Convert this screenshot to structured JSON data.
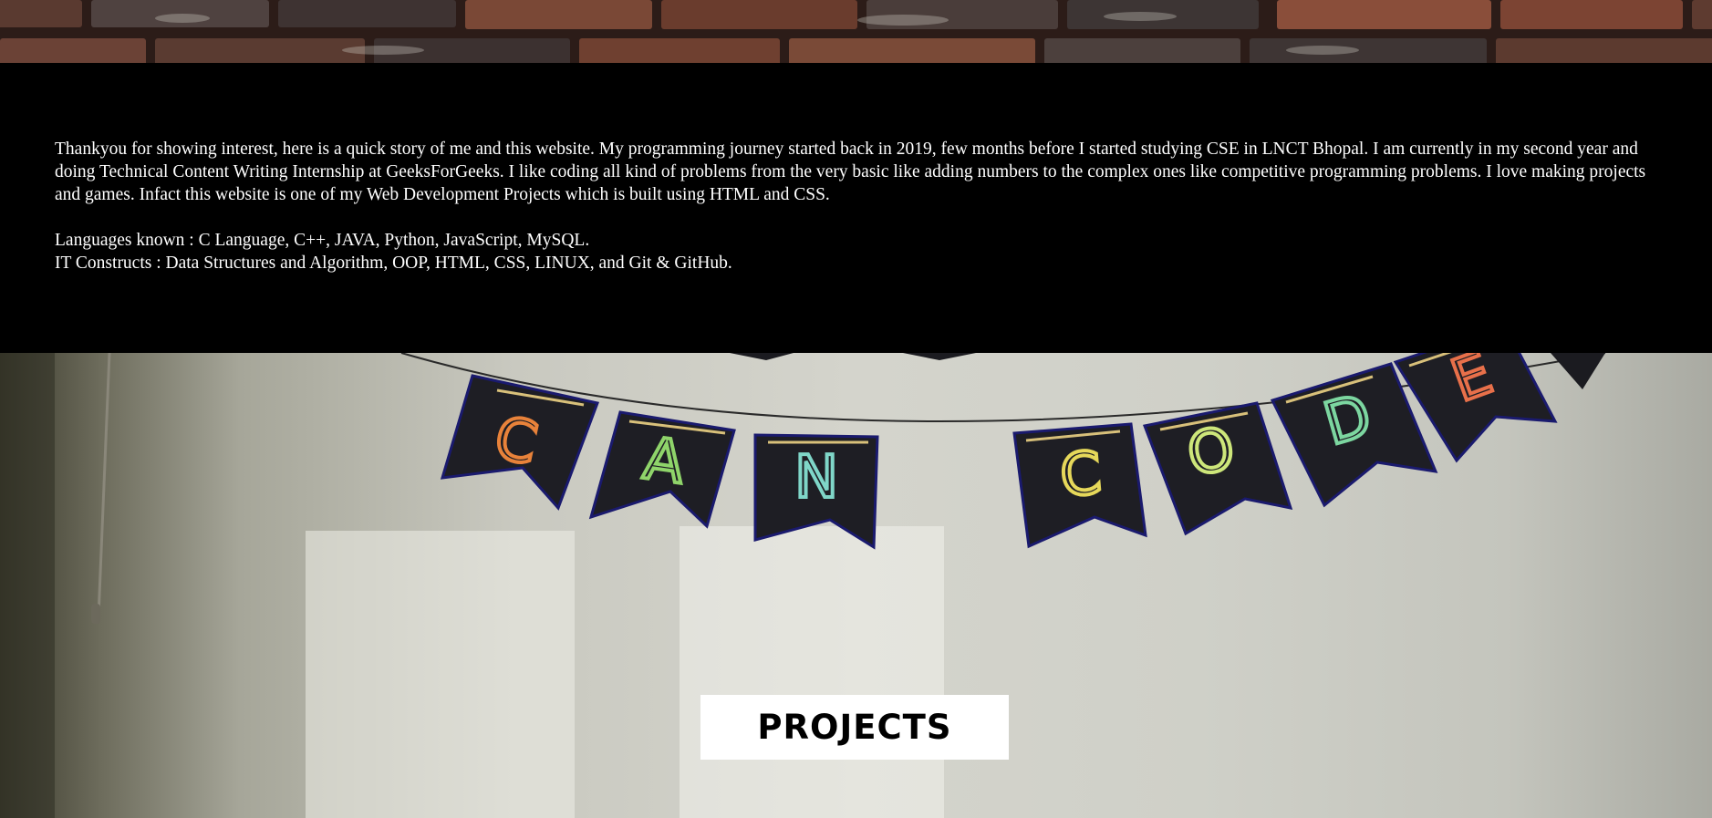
{
  "about": {
    "paragraph": "Thankyou for showing interest, here is a quick story of me and this website. My programming journey started back in 2019, few months before I started studying CSE in LNCT Bhopal. I am currently in my second year and doing Technical Content Writing Internship at GeeksForGeeks. I like coding all kind of problems from the very basic like adding numbers to the complex ones like competitive programming problems. I love making projects and games. Infact this website is one of my Web Development Projects which is built using HTML and CSS.",
    "languages": "Languages known : C Language, C++, JAVA, Python, JavaScript, MySQL.",
    "it_constructs": "IT Constructs : Data Structures and Algorithm, OOP, HTML, CSS, LINUX, and Git & GitHub."
  },
  "banner": {
    "letters": [
      "C",
      "A",
      "N",
      "C",
      "O",
      "D",
      "E"
    ],
    "letter_colors": [
      "#e8823a",
      "#8fd46a",
      "#7fd6c8",
      "#e6d85a",
      "#cde67a",
      "#7cd6a0",
      "#e8704a"
    ]
  },
  "projects": {
    "label": "PROJECTS"
  },
  "colors": {
    "section_bg": "#000000",
    "text": "#ffffff",
    "button_bg": "#ffffff",
    "button_text": "#000000"
  }
}
